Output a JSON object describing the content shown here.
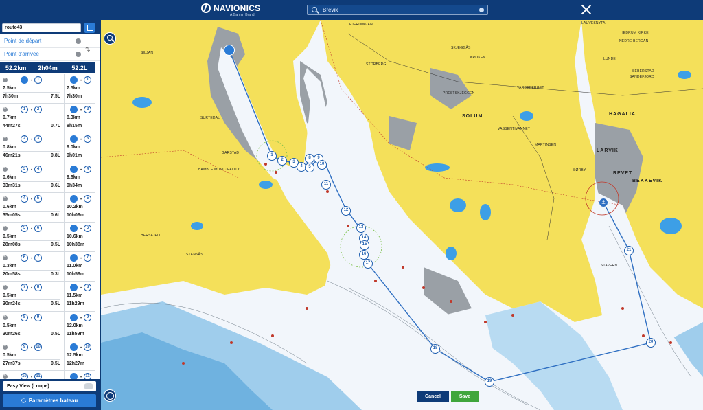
{
  "header": {
    "brand": "NAVIONICS",
    "brand_sub": "A Garmin Brand",
    "search_value": "Brevik"
  },
  "sidebar": {
    "route_name": "route43",
    "start_point_placeholder": "Point de départ",
    "end_point_placeholder": "Point d'arrivée",
    "summary": {
      "distance": "52.2km",
      "time": "2h04m",
      "fuel": "52.2L"
    },
    "legs": [
      {
        "from": "",
        "to": "1",
        "dist": "7.5km",
        "time": "7h30m",
        "fuel": "7.5L",
        "cum_dist": "7.5km",
        "cum_time": "7h30m"
      },
      {
        "from": "1",
        "to": "2",
        "dist": "0.7km",
        "time": "44m27s",
        "fuel": "0.7L",
        "cum_dist": "8.3km",
        "cum_time": "8h15m"
      },
      {
        "from": "2",
        "to": "3",
        "dist": "0.8km",
        "time": "46m21s",
        "fuel": "0.8L",
        "cum_dist": "9.0km",
        "cum_time": "9h01m"
      },
      {
        "from": "3",
        "to": "4",
        "dist": "0.6km",
        "time": "33m31s",
        "fuel": "0.6L",
        "cum_dist": "9.6km",
        "cum_time": "9h34m"
      },
      {
        "from": "4",
        "to": "5",
        "dist": "0.6km",
        "time": "35m05s",
        "fuel": "0.6L",
        "cum_dist": "10.2km",
        "cum_time": "10h09m"
      },
      {
        "from": "5",
        "to": "6",
        "dist": "0.5km",
        "time": "28m08s",
        "fuel": "0.5L",
        "cum_dist": "10.6km",
        "cum_time": "10h38m"
      },
      {
        "from": "6",
        "to": "7",
        "dist": "0.3km",
        "time": "20m58s",
        "fuel": "0.3L",
        "cum_dist": "11.0km",
        "cum_time": "10h59m"
      },
      {
        "from": "7",
        "to": "8",
        "dist": "0.5km",
        "time": "30m24s",
        "fuel": "0.5L",
        "cum_dist": "11.5km",
        "cum_time": "11h29m"
      },
      {
        "from": "8",
        "to": "9",
        "dist": "0.5km",
        "time": "30m26s",
        "fuel": "0.5L",
        "cum_dist": "12.0km",
        "cum_time": "11h59m"
      },
      {
        "from": "9",
        "to": "10",
        "dist": "0.5km",
        "time": "27m37s",
        "fuel": "0.5L",
        "cum_dist": "12.5km",
        "cum_time": "12h27m"
      },
      {
        "from": "10",
        "to": "11",
        "dist": "",
        "time": "",
        "fuel": "",
        "cum_dist": "",
        "cum_time": ""
      }
    ],
    "easy_view_label": "Easy View (Loupe)",
    "params_button": "Paramètres bateau"
  },
  "map": {
    "labels": [
      {
        "text": "FJERDINGEN"
      },
      {
        "text": "LAUVESNYTA"
      },
      {
        "text": "HEDRUM KIRKE"
      },
      {
        "text": "NEDRE BERGAN"
      },
      {
        "text": "LUNDE"
      },
      {
        "text": "SKJEGGÅS"
      },
      {
        "text": "KROKEN"
      },
      {
        "text": "STORBERG"
      },
      {
        "text": "PRESTSKJEGGEN"
      },
      {
        "text": "VARDEBERGET"
      },
      {
        "text": "SEBERSTAD"
      },
      {
        "text": "SANDEFJORD"
      },
      {
        "text": "SOLUM"
      },
      {
        "text": "HAGALIA"
      },
      {
        "text": "LARVIK"
      },
      {
        "text": "REVET"
      },
      {
        "text": "BEKKEVIK"
      },
      {
        "text": "SURTEDAL"
      },
      {
        "text": "GARSTAD"
      },
      {
        "text": "BAMBLE MUNICIPALITY"
      },
      {
        "text": "HERSFJELL"
      },
      {
        "text": "STAVERN"
      },
      {
        "text": "MARTINSEN"
      },
      {
        "text": "SØRBY"
      },
      {
        "text": "VASSENTIVANNET"
      },
      {
        "text": "SILJAN"
      },
      {
        "text": "STENSÅS"
      }
    ],
    "waypoints": [
      "1",
      "2",
      "3",
      "4",
      "5",
      "8",
      "9",
      "10",
      "11",
      "12",
      "13",
      "14",
      "15",
      "16",
      "17",
      "18",
      "19",
      "20",
      "21"
    ],
    "cancel_label": "Cancel",
    "save_label": "Save"
  }
}
